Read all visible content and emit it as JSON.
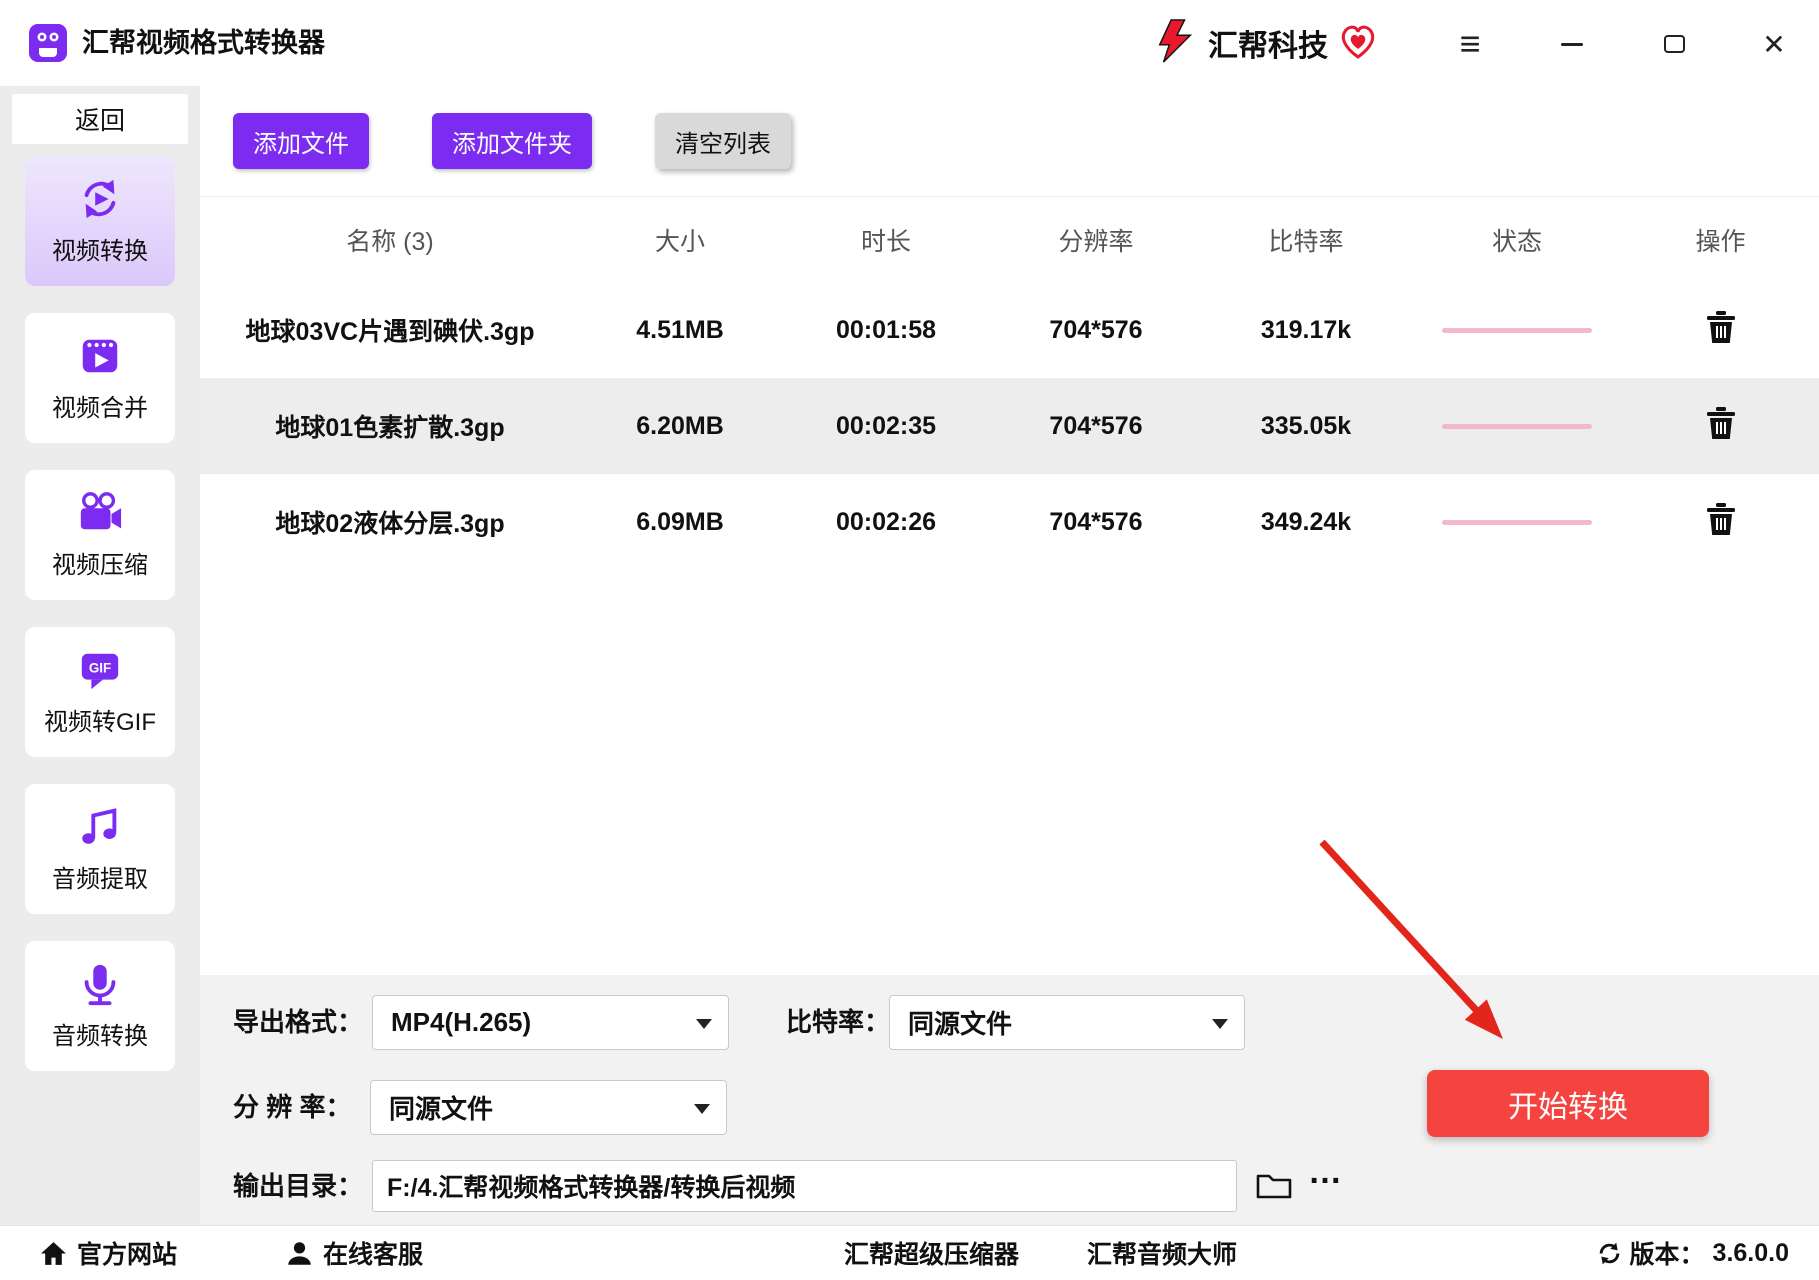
{
  "window": {
    "title": "汇帮视频格式转换器",
    "brand": "汇帮科技",
    "controls": {
      "menu": "≡",
      "close": "✕"
    }
  },
  "sidebar": {
    "back_label": "返回",
    "items": [
      {
        "label": "视频转换",
        "icon": "video-convert-icon",
        "active": true
      },
      {
        "label": "视频合并",
        "icon": "video-merge-icon",
        "active": false
      },
      {
        "label": "视频压缩",
        "icon": "video-compress-icon",
        "active": false
      },
      {
        "label": "视频转GIF",
        "icon": "video-to-gif-icon",
        "active": false
      },
      {
        "label": "音频提取",
        "icon": "audio-extract-icon",
        "active": false
      },
      {
        "label": "音频转换",
        "icon": "audio-convert-icon",
        "active": false
      }
    ]
  },
  "toolbar": {
    "add_file": "添加文件",
    "add_folder": "添加文件夹",
    "clear_list": "清空列表"
  },
  "table": {
    "headers": [
      "名称 (3)",
      "大小",
      "时长",
      "分辨率",
      "比特率",
      "状态",
      "操作"
    ],
    "rows": [
      {
        "name": "地球03VC片遇到碘伏.3gp",
        "size": "4.51MB",
        "duration": "00:01:58",
        "resolution": "704*576",
        "bitrate": "319.17k"
      },
      {
        "name": "地球01色素扩散.3gp",
        "size": "6.20MB",
        "duration": "00:02:35",
        "resolution": "704*576",
        "bitrate": "335.05k"
      },
      {
        "name": "地球02液体分层.3gp",
        "size": "6.09MB",
        "duration": "00:02:26",
        "resolution": "704*576",
        "bitrate": "349.24k"
      }
    ]
  },
  "settings": {
    "export_format_label": "导出格式：",
    "export_format_value": "MP4(H.265)",
    "bitrate_label": "比特率：",
    "bitrate_value": "同源文件",
    "resolution_label": "分 辨 率：",
    "resolution_value": "同源文件",
    "output_dir_label": "输出目录：",
    "output_dir_value": "F:/4.汇帮视频格式转换器/转换后视频",
    "more": "…",
    "start_button": "开始转换"
  },
  "statusbar": {
    "official_site": "官方网站",
    "online_service": "在线客服",
    "super_compressor": "汇帮超级压缩器",
    "audio_master": "汇帮音频大师",
    "version_label": "版本：",
    "version_value": "3.6.0.0"
  },
  "colors": {
    "accent_purple": "#7b2cf0",
    "start_red": "#f5433f",
    "progress_pink": "#f5b8ca",
    "annotation_arrow_red": "#e2261b"
  }
}
